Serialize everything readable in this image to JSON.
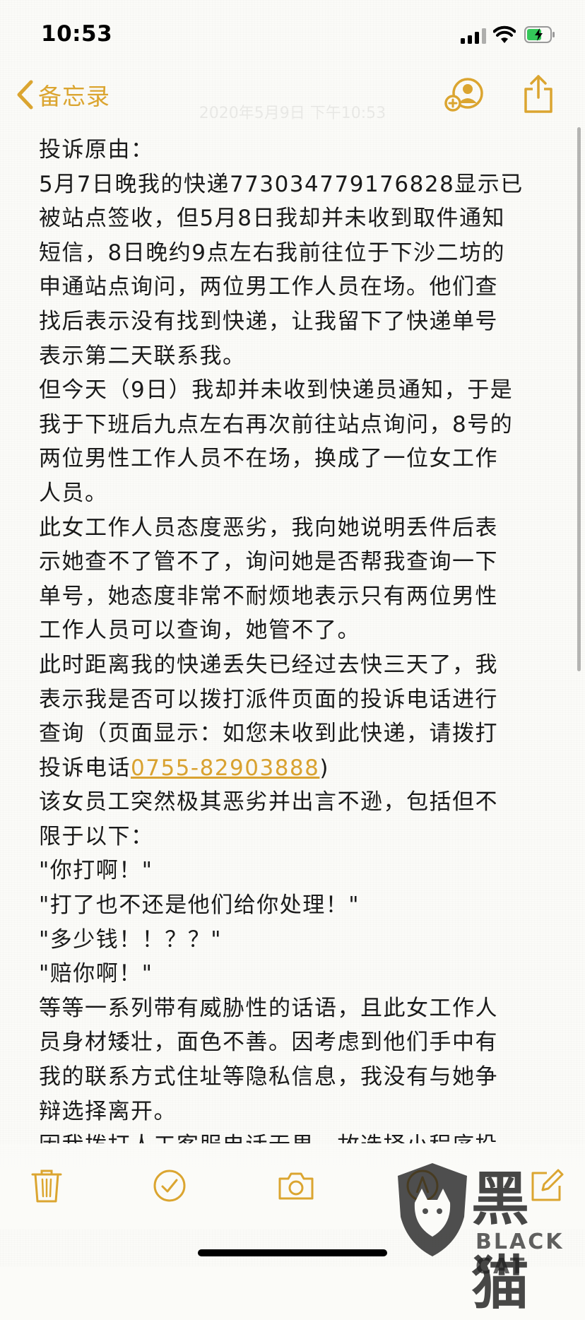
{
  "status_bar": {
    "time": "10:53",
    "battery_color": "#34c759"
  },
  "nav": {
    "back_label": "备忘录",
    "date_text": "2020年5月9日 下午10:53",
    "accent_color": "#dba530",
    "collab_icon": "person-add-icon",
    "share_icon": "share-icon"
  },
  "note": {
    "lines": [
      "投诉原由：",
      "5月7日晚我的快递773034779176828显示已",
      "被站点签收，但5月8日我却并未收到取件通知",
      "短信，8日晚约9点左右我前往位于下沙二坊的",
      "申通站点询问，两位男工作人员在场。他们查",
      "找后表示没有找到快递，让我留下了快递单号",
      "表示第二天联系我。",
      "但今天（9日）我却并未收到快递员通知，于是",
      "我于下班后九点左右再次前往站点询问，8号的",
      "两位男性工作人员不在场，换成了一位女工作",
      "人员。",
      "此女工作人员态度恶劣，我向她说明丢件后表",
      "示她查不了管不了，询问她是否帮我查询一下",
      "单号，她态度非常不耐烦地表示只有两位男性",
      "工作人员可以查询，她管不了。",
      "此时距离我的快递丢失已经过去快三天了，我",
      "表示我是否可以拨打派件页面的投诉电话进行",
      "查询（页面显示：如您未收到此快递，请拨打",
      "",
      "该女员工突然极其恶劣并出言不逊，包括但不",
      "限于以下：",
      "\"你打啊！\"",
      "\"打了也不还是他们给你处理！\"",
      "\"多少钱！！？？\"",
      "\"赔你啊！\"",
      "等等一系列带有威胁性的话语，且此女工作人",
      "员身材矮壮，面色不善。因考虑到他们手中有",
      "我的联系方式住址等隐私信息，我没有与她争",
      "辩选择离开。",
      "因我拨打人工客服电话无果，故选择小程序投"
    ],
    "phone_line": {
      "prefix": "投诉电话",
      "phone": "0755-82903888",
      "suffix": ")"
    }
  },
  "toolbar": {
    "items": [
      "trash-icon",
      "checklist-icon",
      "camera-icon",
      "markup-icon",
      "compose-icon"
    ]
  },
  "watermark": {
    "cn": "黑猫",
    "en": "BLACK CAT"
  }
}
